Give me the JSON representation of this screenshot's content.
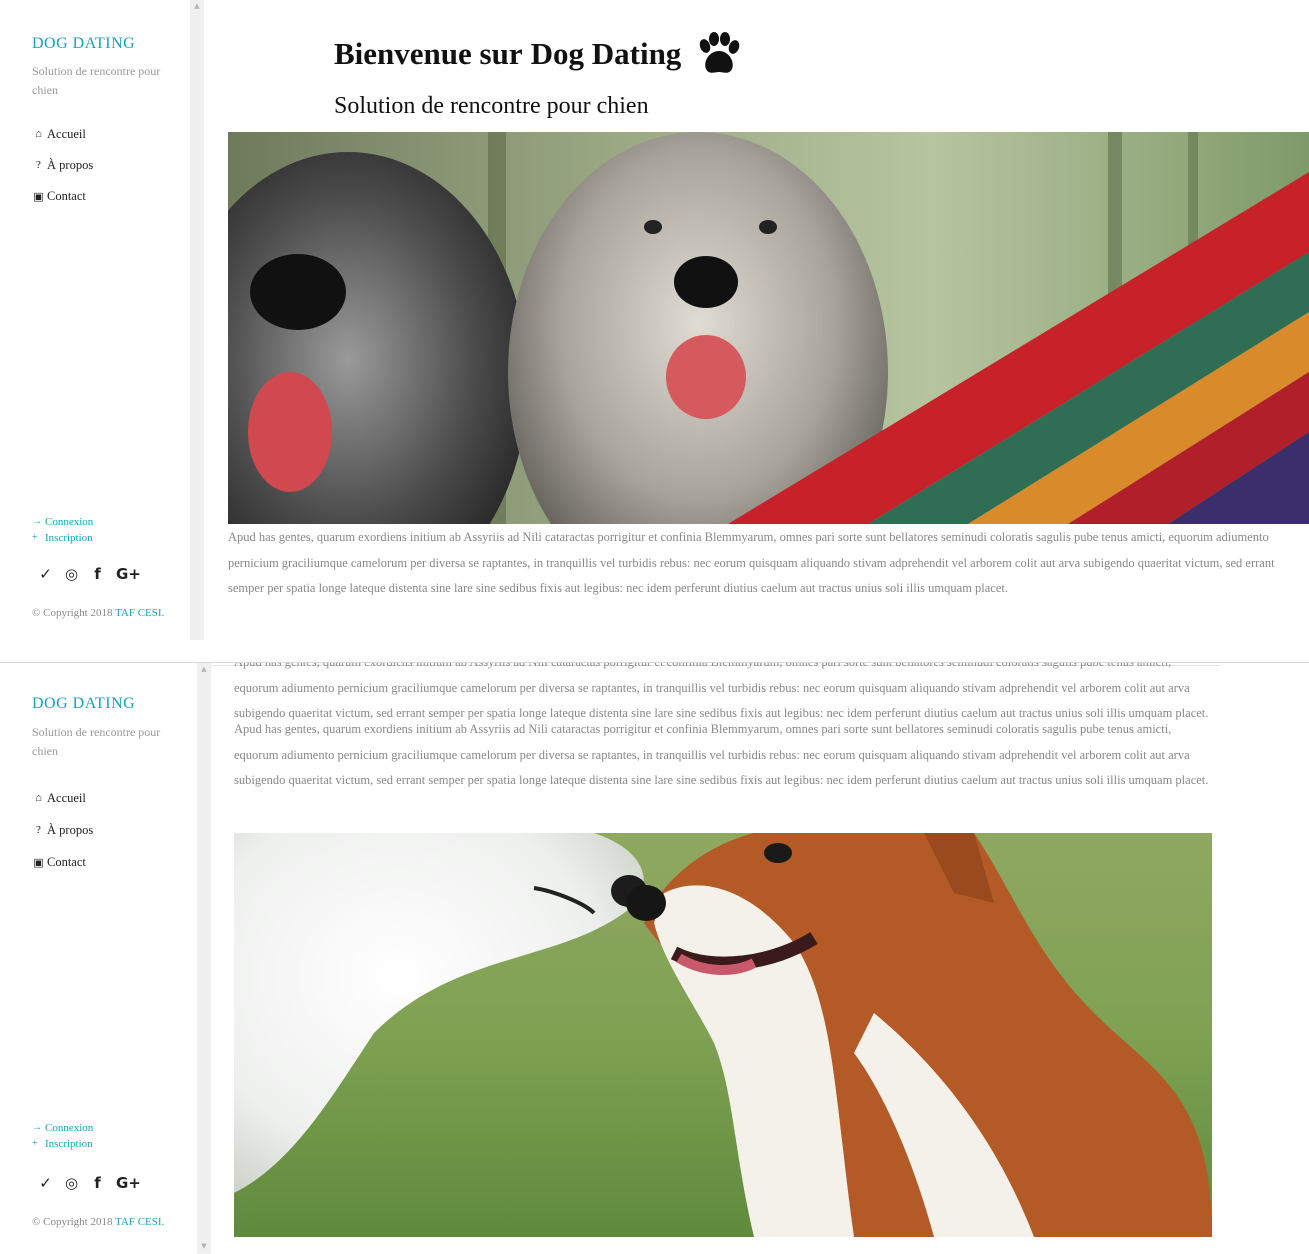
{
  "sidebar": {
    "title": "DOG DATING",
    "subtitle": "Solution de rencontre pour chien",
    "nav": [
      {
        "label": "Accueil",
        "icon": "home-icon",
        "glyph": "⌂"
      },
      {
        "label": "À propos",
        "icon": "question-circle-icon",
        "glyph": "?"
      },
      {
        "label": "Contact",
        "icon": "contact-card-icon",
        "glyph": "▣"
      }
    ],
    "auth": [
      {
        "label": "Connexion",
        "icon": "sign-in-icon",
        "glyph": "→"
      },
      {
        "label": "Inscription",
        "icon": "user-plus-icon",
        "glyph": "+"
      }
    ],
    "social": [
      {
        "icon": "twitter-icon",
        "glyph": "✓"
      },
      {
        "icon": "instagram-icon",
        "glyph": "◎"
      },
      {
        "icon": "facebook-icon",
        "glyph": "f"
      },
      {
        "icon": "google-plus-icon",
        "glyph": "G+"
      }
    ],
    "copyright_prefix": "© Copyright 2018",
    "copyright_brand": "TAF CESI."
  },
  "main": {
    "title_prefix": "Bienvenue sur",
    "title_brand": "Dog Dating",
    "title_icon": "paw-icon",
    "subtitle": "Solution de rencontre pour chien",
    "hero_image": "two-shaggy-dogs-and-colorful-hammock-photo",
    "paragraph": "Apud has gentes, quarum exordiens initium ab Assyriis ad Nili cataractas porrigitur et confinia Blemmyarum, omnes pari sorte sunt bellatores seminudi coloratis sagulis pube tenus amicti, equorum adiumento pernicium graciliumque camelorum per diversa se raptantes, in tranquillis vel turbidis rebus: nec eorum quisquam aliquando stivam adprehendit vel arborem colit aut arva subigendo quaeritat victum, sed errant semper per spatia longe lateque distenta sine lare sine sedibus fixis aut legibus: nec idem perferunt diutius caelum aut tractus unius soli illis umquam placet.",
    "bottom_image": "white-dog-and-corgi-nose-to-nose-photo"
  },
  "colors": {
    "accent": "#17a2b8",
    "muted_text": "#888888",
    "scrollbar": "#f0f0f0"
  }
}
